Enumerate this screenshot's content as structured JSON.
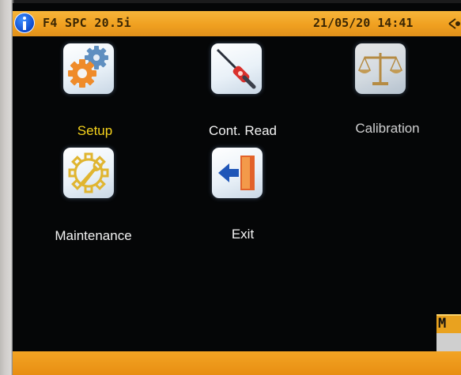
{
  "status_bar": {
    "device_name": "F4 SPC 20.5i",
    "datetime": "21/05/20 14:41"
  },
  "menu": {
    "items": [
      {
        "label": "Setup",
        "icon": "gears-icon",
        "selected": true
      },
      {
        "label": "Cont. Read",
        "icon": "probe-reader-icon",
        "selected": false
      },
      {
        "label": "Calibration",
        "icon": "balance-scale-icon",
        "selected": false
      },
      {
        "label": "Maintenance",
        "icon": "wrench-gear-icon",
        "selected": false
      },
      {
        "label": "Exit",
        "icon": "exit-door-icon",
        "selected": false
      }
    ]
  },
  "popup": {
    "title_fragment": "M"
  },
  "colors": {
    "status_bar": "#f0a020",
    "selected_label": "#f5d21c",
    "label": "#f2f2f2",
    "screen_bg": "#050607"
  }
}
